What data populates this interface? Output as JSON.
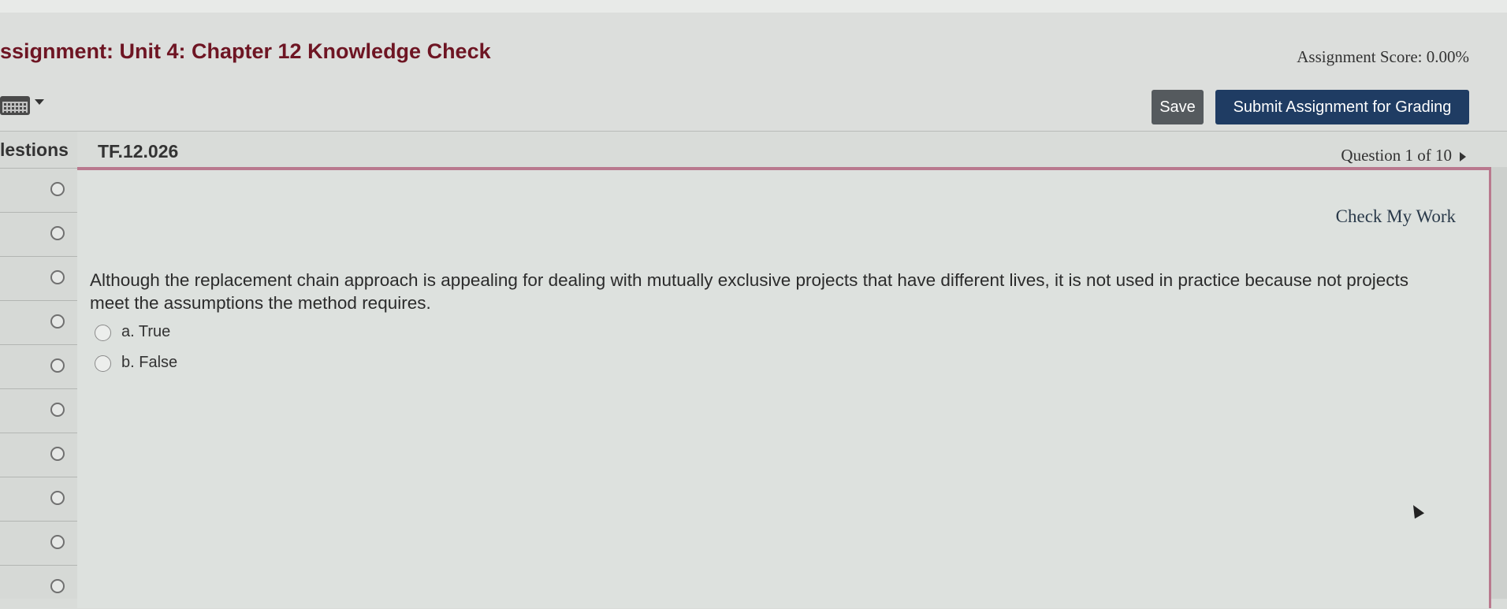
{
  "header": {
    "title": "ssignment: Unit 4: Chapter 12 Knowledge Check",
    "score": "Assignment Score: 0.00%",
    "keyboard_icon": "keyboard-icon",
    "save_label": "Save",
    "submit_label": "Submit Assignment for Grading"
  },
  "sidebar": {
    "heading": "lestions",
    "items": [
      {
        "status": "unanswered"
      },
      {
        "status": "unanswered"
      },
      {
        "status": "unanswered"
      },
      {
        "status": "unanswered"
      },
      {
        "status": "unanswered"
      },
      {
        "status": "unanswered"
      },
      {
        "status": "unanswered"
      },
      {
        "status": "unanswered"
      },
      {
        "status": "unanswered"
      },
      {
        "status": "unanswered"
      }
    ]
  },
  "question": {
    "id": "TF.12.026",
    "nav": "Question 1 of 10",
    "check_label": "Check My Work",
    "text": "Although the replacement chain approach is appealing for dealing with mutually exclusive projects that have different lives, it is not used in practice because not projects meet the assumptions the method requires.",
    "options": [
      {
        "label": "a. True",
        "selected": false
      },
      {
        "label": "b. False",
        "selected": false
      }
    ]
  },
  "colors": {
    "title": "#6e1523",
    "submit_button": "#1f3c63",
    "save_button": "#555a5e",
    "panel_border": "#b9798e"
  }
}
